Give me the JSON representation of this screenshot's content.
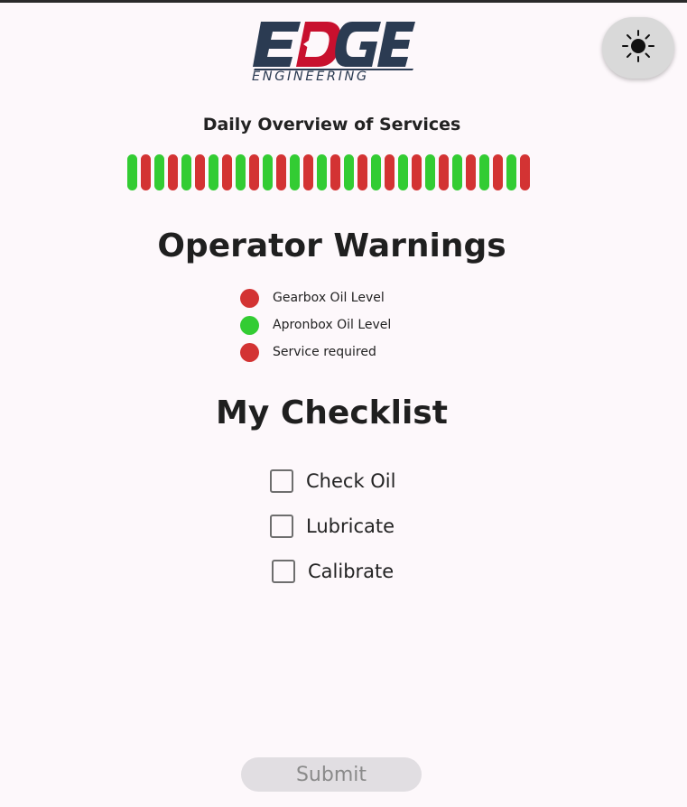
{
  "header": {
    "logo": {
      "wordmark": "EDGE",
      "subtitle": "ENGINEERING",
      "colors": {
        "dark": "#2b3b52",
        "accent": "#c8102e"
      }
    },
    "theme_toggle": {
      "icon": "sun-icon"
    }
  },
  "services": {
    "title": "Daily Overview of Services",
    "statuses": [
      "green",
      "red",
      "green",
      "red",
      "green",
      "red",
      "green",
      "red",
      "green",
      "red",
      "green",
      "red",
      "green",
      "red",
      "green",
      "red",
      "green",
      "red",
      "green",
      "red",
      "green",
      "red",
      "green",
      "red",
      "green",
      "red",
      "green",
      "red",
      "green",
      "red"
    ],
    "colors": {
      "green": "#33cc33",
      "red": "#d33333"
    }
  },
  "warnings": {
    "heading": "Operator Warnings",
    "items": [
      {
        "label": "Gearbox Oil Level",
        "status": "red"
      },
      {
        "label": "Apronbox Oil Level",
        "status": "green"
      },
      {
        "label": "Service required",
        "status": "red"
      }
    ]
  },
  "checklist": {
    "heading": "My Checklist",
    "items": [
      {
        "label": "Check Oil",
        "checked": false
      },
      {
        "label": "Lubricate",
        "checked": false
      },
      {
        "label": "Calibrate",
        "checked": false
      }
    ]
  },
  "submit_label": "Submit"
}
